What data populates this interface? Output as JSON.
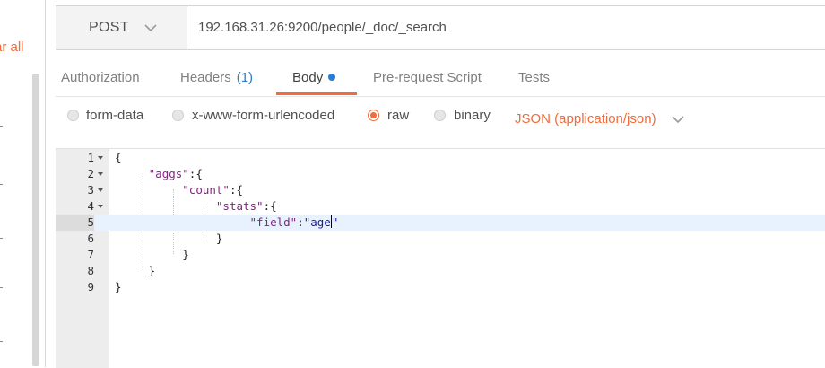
{
  "sidebar": {
    "clear_all": "ar all"
  },
  "request": {
    "method": "POST",
    "url": "192.168.31.26:9200/people/_doc/_search"
  },
  "tabs": [
    {
      "label": "Authorization"
    },
    {
      "label": "Headers",
      "count": "(1)"
    },
    {
      "label": "Body",
      "active": true,
      "modified_dot": true
    },
    {
      "label": "Pre-request Script"
    },
    {
      "label": "Tests"
    }
  ],
  "body_types": [
    {
      "label": "form-data",
      "checked": false
    },
    {
      "label": "x-www-form-urlencoded",
      "checked": false
    },
    {
      "label": "raw",
      "checked": true
    },
    {
      "label": "binary",
      "checked": false
    }
  ],
  "content_type": "JSON (application/json)",
  "editor": {
    "active_line": 5,
    "lines": [
      {
        "num": "1",
        "text": "{"
      },
      {
        "num": "2",
        "text": "    \"aggs\":{"
      },
      {
        "num": "3",
        "text": "        \"count\":{"
      },
      {
        "num": "4",
        "text": "            \"stats\":{"
      },
      {
        "num": "5",
        "text": "                \"field\":\"age\""
      },
      {
        "num": "6",
        "text": "            }"
      },
      {
        "num": "7",
        "text": "        }"
      },
      {
        "num": "8",
        "text": "    }"
      },
      {
        "num": "9",
        "text": "}"
      }
    ]
  },
  "colors": {
    "accent": "#f26b3a",
    "link": "#2a7bd4",
    "json_key": "#8a1f8a",
    "json_string": "#1a1aa6"
  }
}
